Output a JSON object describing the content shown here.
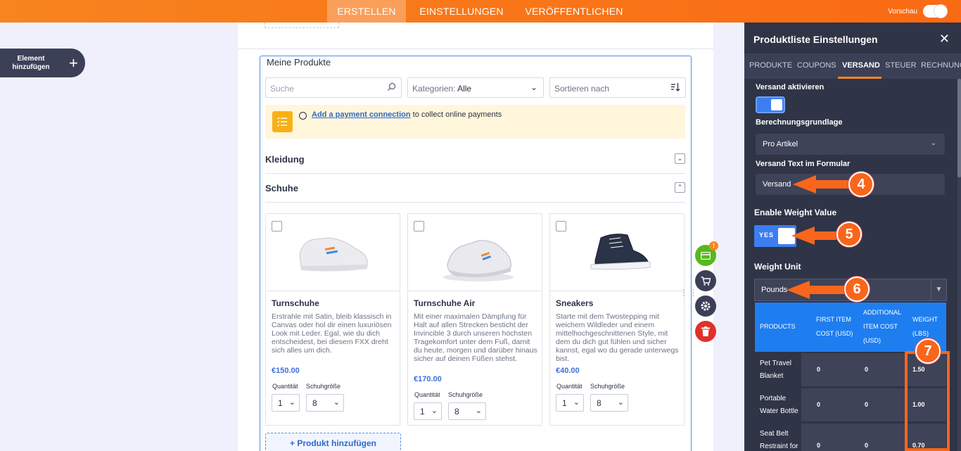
{
  "topbar": {
    "tabs": [
      {
        "label": "ERSTELLEN",
        "active": true
      },
      {
        "label": "EINSTELLUNGEN",
        "active": false
      },
      {
        "label": "VERÖFFENTLICHEN",
        "active": false
      }
    ],
    "preview_label": "Vorschau",
    "preview_on": false
  },
  "left": {
    "add_element_label": "Element hinzufügen"
  },
  "widget": {
    "title": "Meine Produkte",
    "search_placeholder": "Suche",
    "category_label": "Kategorien:",
    "category_value": "Alle",
    "sort_label": "Sortieren nach",
    "notice_link": "Add a payment connection",
    "notice_text": " to collect online payments",
    "categories": [
      {
        "name": "Kleidung",
        "expanded": false
      },
      {
        "name": "Schuhe",
        "expanded": true
      }
    ],
    "products": [
      {
        "name": "Turnschuhe",
        "desc": "Erstrahle mit Satin, bleib klassisch in Canvas oder hol dir einen luxuriösen Look mit Leder. Egal, wie du dich entscheidest, bei diesem FXX dreht sich alles um dich.",
        "price": "€150.00",
        "qty_label": "Quantität",
        "size_label": "Schuhgröße",
        "qty": "1",
        "size": "8"
      },
      {
        "name": "Turnschuhe Air",
        "desc": "Mit einer maximalen Dämpfung für Halt auf allen Strecken besticht der Invincible 3 durch unseren höchsten Tragekomfort unter dem Fuß, damit du heute, morgen und darüber hinaus sicher auf deinen Füßen stehst.",
        "price": "€170.00",
        "qty_label": "Quantität",
        "size_label": "Schuhgröße",
        "qty": "1",
        "size": "8"
      },
      {
        "name": "Sneakers",
        "desc": "Starte mit dem Twostepping mit weichem Wildleder und einem mittelhochgeschnittenen Style, mit dem du dich gut fühlen und sicher kannst, egal wo du gerade unterwegs bist.",
        "price": "€40.00",
        "qty_label": "Quantität",
        "size_label": "Schuhgröße",
        "qty": "1",
        "size": "8"
      }
    ],
    "add_product_label": "+ Produkt hinzufügen"
  },
  "side_tools": {
    "badge": "!",
    "colors": {
      "payment": "#57b81d",
      "cart": "#3b4057",
      "settings": "#3b4057",
      "delete": "#e0302a"
    }
  },
  "panel": {
    "title": "Produktliste Einstellungen",
    "close": "✕",
    "tabs": [
      "PRODUKTE",
      "COUPONS",
      "VERSAND",
      "STEUER",
      "RECHNUNG"
    ],
    "active_tab": "VERSAND",
    "shipping_enable_label": "Versand aktivieren",
    "calc_basis_label": "Berechnungsgrundlage",
    "calc_basis_value": "Pro Artikel",
    "shipping_text_label": "Versand Text im Formular",
    "shipping_text_value": "Versand",
    "weight_value_label": "Enable Weight Value",
    "weight_value_toggle": "YES",
    "weight_unit_label": "Weight Unit",
    "weight_unit_value": "Pounds",
    "table": {
      "headers": [
        "PRODUCTS",
        "FIRST ITEM COST (USD)",
        "ADDITIONAL ITEM COST (USD)",
        "WEIGHT (LBS)"
      ],
      "rows": [
        {
          "product": "Pet Travel Blanket",
          "first": "0",
          "additional": "0",
          "weight": "1.50"
        },
        {
          "product": "Portable Water Bottle",
          "first": "0",
          "additional": "0",
          "weight": "1.00"
        },
        {
          "product": "Seat Belt Restraint for",
          "first": "0",
          "additional": "0",
          "weight": "0.70"
        }
      ]
    }
  },
  "annotations": [
    "4",
    "5",
    "6",
    "7"
  ],
  "colors": {
    "accent": "#f7851e",
    "blue": "#1e7ef0",
    "panel": "#2f3447"
  }
}
